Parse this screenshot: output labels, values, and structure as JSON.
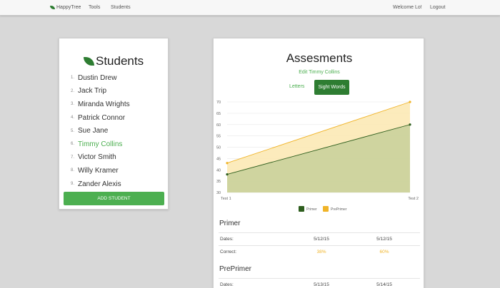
{
  "nav": {
    "brand": "HappyTree",
    "tools": "Tools",
    "students": "Students",
    "welcome": "Welcome Lo!",
    "logout": "Logout"
  },
  "students_panel": {
    "title": "Students",
    "items": [
      {
        "num": "1.",
        "name": "Dustin Drew"
      },
      {
        "num": "2.",
        "name": "Jack Trip"
      },
      {
        "num": "3.",
        "name": "Miranda Wrights"
      },
      {
        "num": "4.",
        "name": "Patrick Connor"
      },
      {
        "num": "5.",
        "name": "Sue Jane"
      },
      {
        "num": "6.",
        "name": "Timmy Collins"
      },
      {
        "num": "7.",
        "name": "Victor Smith"
      },
      {
        "num": "8.",
        "name": "Willy Kramer"
      },
      {
        "num": "9.",
        "name": "Zander Alexis"
      }
    ],
    "active_index": 5,
    "add_button": "ADD STUDENT"
  },
  "assessments": {
    "title": "Assesments",
    "edit_link": "Edit Timmy Collins",
    "tab_letters": "Letters",
    "tab_sight_words": "Sight Words",
    "sections": [
      {
        "title": "Primer",
        "rows": [
          {
            "label": "Dates:",
            "v1": "5/12/15",
            "v2": "5/12/15",
            "highlight": false
          },
          {
            "label": "Correct:",
            "v1": "38%",
            "v2": "60%",
            "highlight": true
          }
        ]
      },
      {
        "title": "PrePrimer",
        "rows": [
          {
            "label": "Dates:",
            "v1": "5/13/15",
            "v2": "5/14/15",
            "highlight": false
          }
        ]
      }
    ]
  },
  "colors": {
    "accent_green": "#4caf50",
    "dark_green": "#2e7d32",
    "primer_line": "#2e5e1e",
    "primer_fill": "#c7d09a",
    "preprimer_line": "#f0b429",
    "preprimer_fill": "#fbe7b0"
  },
  "chart_data": {
    "type": "area",
    "categories": [
      "Test 1",
      "Test 2"
    ],
    "series": [
      {
        "name": "Primer",
        "values": [
          38,
          60
        ],
        "color": "#2e5e1e"
      },
      {
        "name": "PrePrimer",
        "values": [
          43,
          70
        ],
        "color": "#f0b429"
      }
    ],
    "ylim": [
      30,
      70
    ],
    "yticks": [
      30,
      35,
      40,
      45,
      50,
      55,
      60,
      65,
      70
    ],
    "grid": true,
    "legend": "bottom-center"
  }
}
